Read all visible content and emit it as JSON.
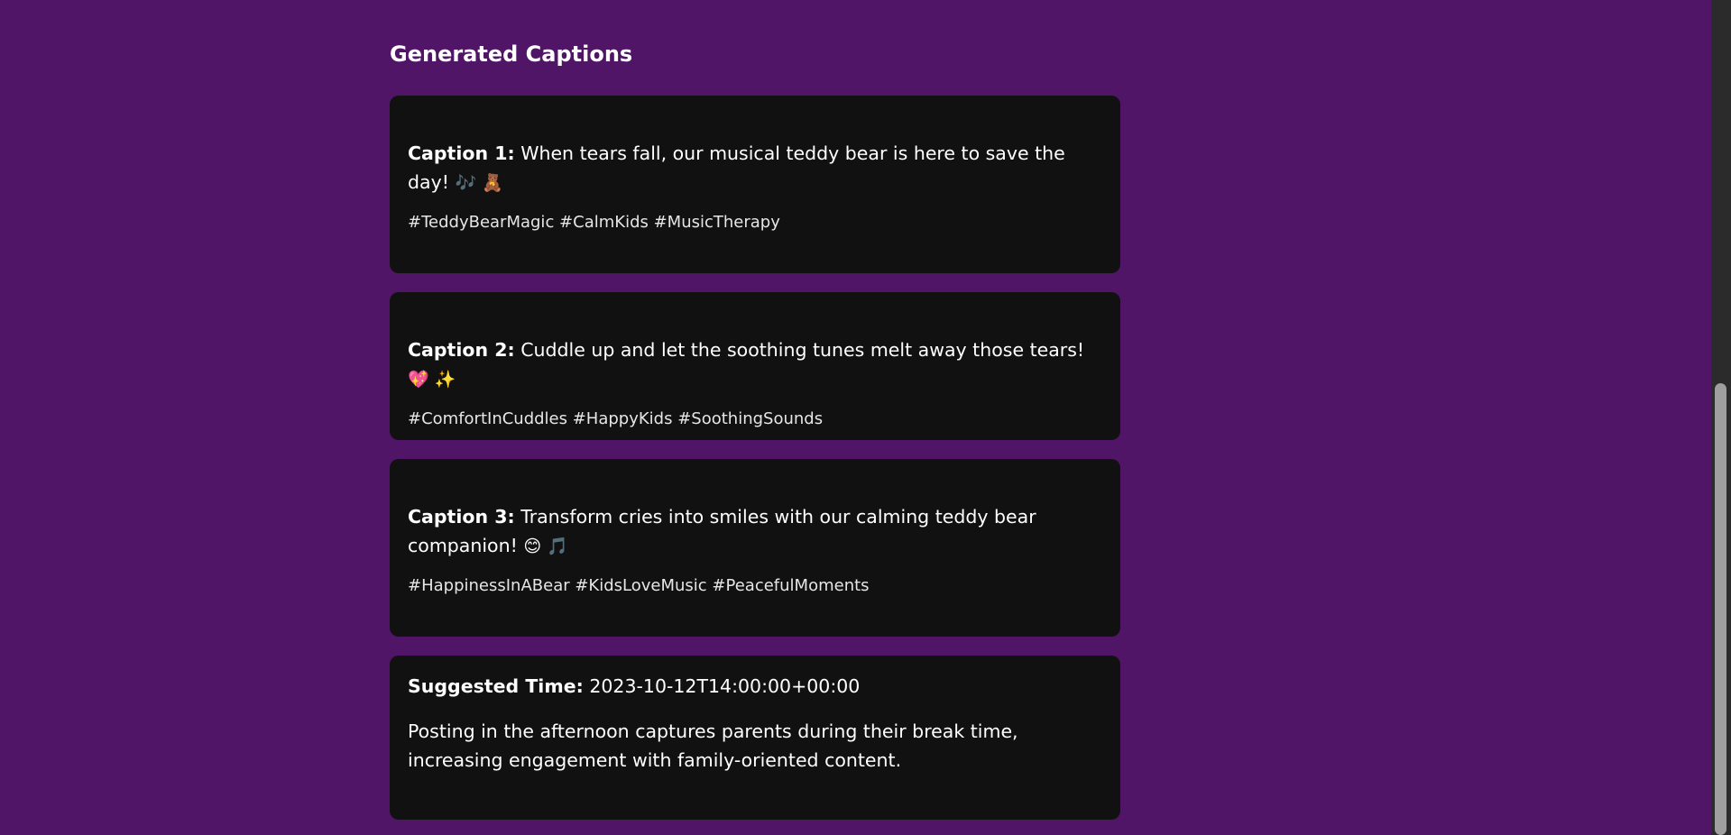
{
  "section": {
    "title": "Generated Captions"
  },
  "captions": [
    {
      "label": "Caption 1:",
      "text": "When tears fall, our musical teddy bear is here to save the day!",
      "emojis": "🎶 🧸",
      "hashtags": "#TeddyBearMagic #CalmKids #MusicTherapy"
    },
    {
      "label": "Caption 2:",
      "text": "Cuddle up and let the soothing tunes melt away those tears!",
      "emojis": "💖 ✨",
      "hashtags": "#ComfortInCuddles #HappyKids #SoothingSounds"
    },
    {
      "label": "Caption 3:",
      "text": "Transform cries into smiles with our calming teddy bear companion!",
      "emojis": "😊 🎵",
      "hashtags": "#HappinessInABear #KidsLoveMusic #PeacefulMoments"
    }
  ],
  "suggestion": {
    "label": "Suggested Time:",
    "value": "2023-10-12T14:00:00+00:00",
    "description": "Posting in the afternoon captures parents during their break time, increasing engagement with family-oriented content."
  },
  "colors": {
    "background": "#501566",
    "card": "#111111",
    "text": "#ffffff"
  }
}
